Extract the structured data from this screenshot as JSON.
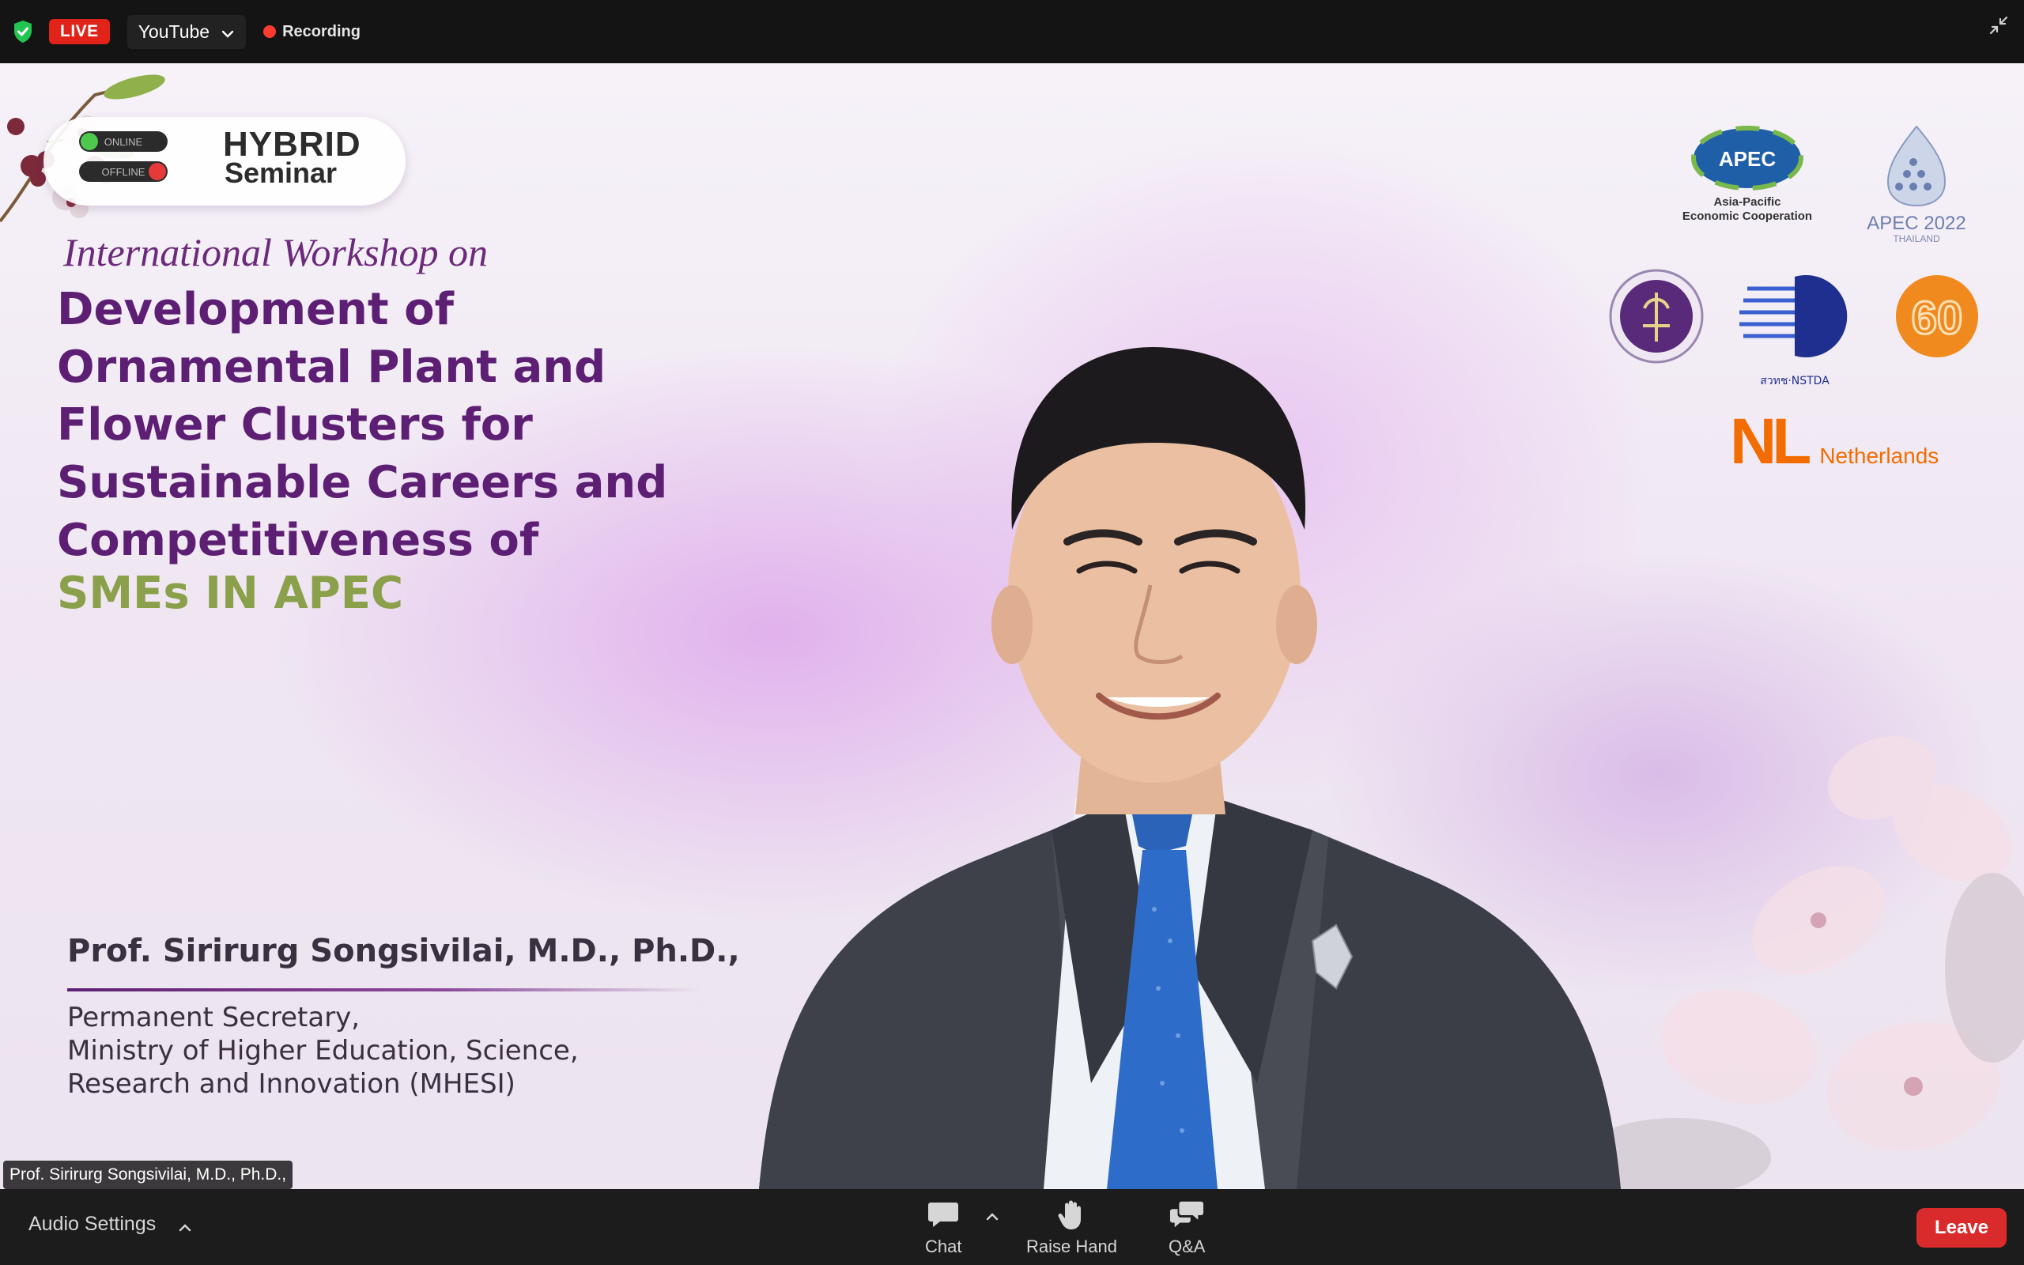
{
  "topbar": {
    "live_label": "LIVE",
    "stream_target": "YouTube",
    "recording_label": "Recording"
  },
  "slide": {
    "badge_online": "ONLINE",
    "badge_offline": "OFFLINE",
    "badge_title": "HYBRID",
    "badge_subtitle": "Seminar",
    "intro": "International Workshop on",
    "title_lines": [
      "Development of",
      "Ornamental Plant and",
      "Flower Clusters for",
      "Sustainable Careers and",
      "Competitiveness of"
    ],
    "title_highlight": "SMEs IN APEC",
    "logos": {
      "apec": "APEC",
      "apec_caption_1": "Asia-Pacific",
      "apec_caption_2": "Economic Cooperation",
      "apec2022": "APEC 2022",
      "apec2022_sub": "THAILAND",
      "nstda": "สวทช·NSTDA",
      "anniv": "60",
      "nl": "NL",
      "netherlands": "Netherlands"
    },
    "speaker_name": "Prof. Sirirurg Songsivilai, M.D., Ph.D.,",
    "speaker_role": [
      "Permanent Secretary,",
      "Ministry of Higher Education, Science,",
      "Research and Innovation (MHESI)"
    ]
  },
  "participant_tag": "Prof. Sirirurg Songsivilai, M.D., Ph.D.,",
  "toolbar": {
    "audio_settings": "Audio Settings",
    "chat": "Chat",
    "raise_hand": "Raise Hand",
    "qa": "Q&A",
    "leave": "Leave"
  },
  "colors": {
    "live_red": "#e2231a",
    "leave_red": "#d92b2b",
    "title_purple": "#5d1f73",
    "highlight_green": "#8aa04a",
    "nl_orange": "#f36c00"
  }
}
